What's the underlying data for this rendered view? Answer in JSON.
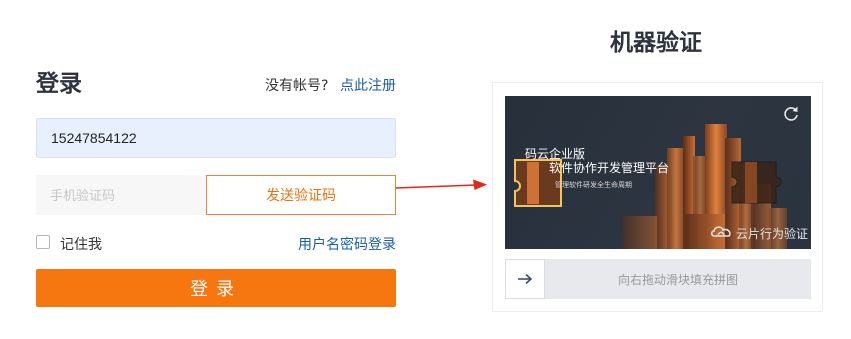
{
  "login": {
    "title": "登录",
    "no_account_text": "没有帐号?",
    "register_link": "点此注册",
    "phone_value": "15247854122",
    "code_placeholder": "手机验证码",
    "send_code_label": "发送验证码",
    "remember_label": "记住我",
    "remember_checked": false,
    "password_login_link": "用户名密码登录",
    "submit_label": "登录"
  },
  "captcha": {
    "title": "机器验证",
    "image_text_line1": "码云企业版",
    "image_text_line2": "软件协作开发管理平台",
    "image_text_line3": "管理软件研发全生命周期",
    "brand_text": "云片行为验证",
    "slider_hint": "向右拖动滑块填充拼图",
    "refresh_icon": "refresh-icon",
    "slider_icon": "arrow-right-icon"
  },
  "colors": {
    "accent_orange": "#f6760f",
    "link_blue": "#1a5ea8",
    "pointer_red": "#e2261c"
  }
}
